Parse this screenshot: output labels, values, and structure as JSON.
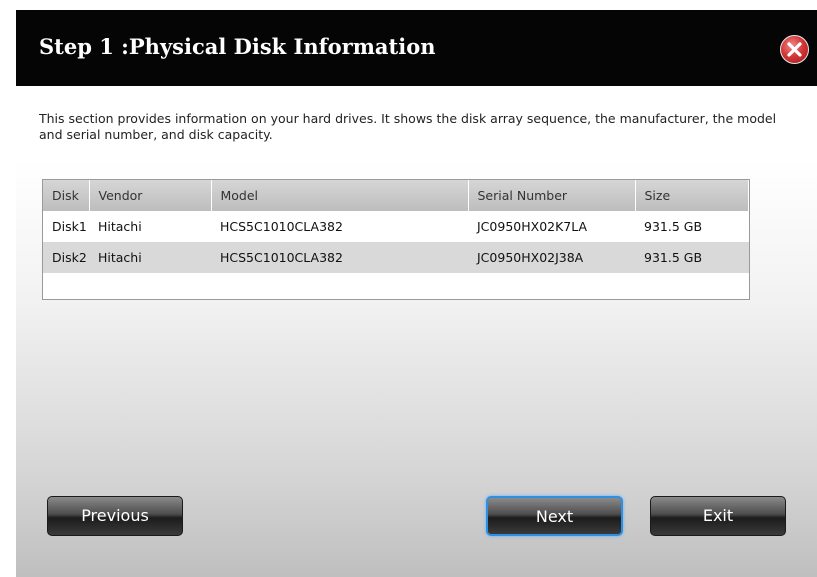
{
  "dialog": {
    "title": "Step 1 :Physical Disk Information",
    "close_icon": "close-icon",
    "description": "This section provides information on your hard drives. It shows the disk array sequence, the manufacturer, the model and serial number, and disk capacity."
  },
  "table": {
    "headers": [
      "Disk",
      "Vendor",
      "Model",
      "Serial Number",
      "Size"
    ],
    "rows": [
      [
        "Disk1",
        "Hitachi",
        "HCS5C1010CLA382",
        "JC0950HX02K7LA",
        "931.5 GB"
      ],
      [
        "Disk2",
        "Hitachi",
        "HCS5C1010CLA382",
        "JC0950HX02J38A",
        "931.5 GB"
      ]
    ]
  },
  "buttons": {
    "previous": "Previous",
    "next": "Next",
    "exit": "Exit"
  },
  "colors": {
    "titlebar": "#050505",
    "close_button": "#d33a3a",
    "next_focus_border": "#2f8fe0"
  }
}
